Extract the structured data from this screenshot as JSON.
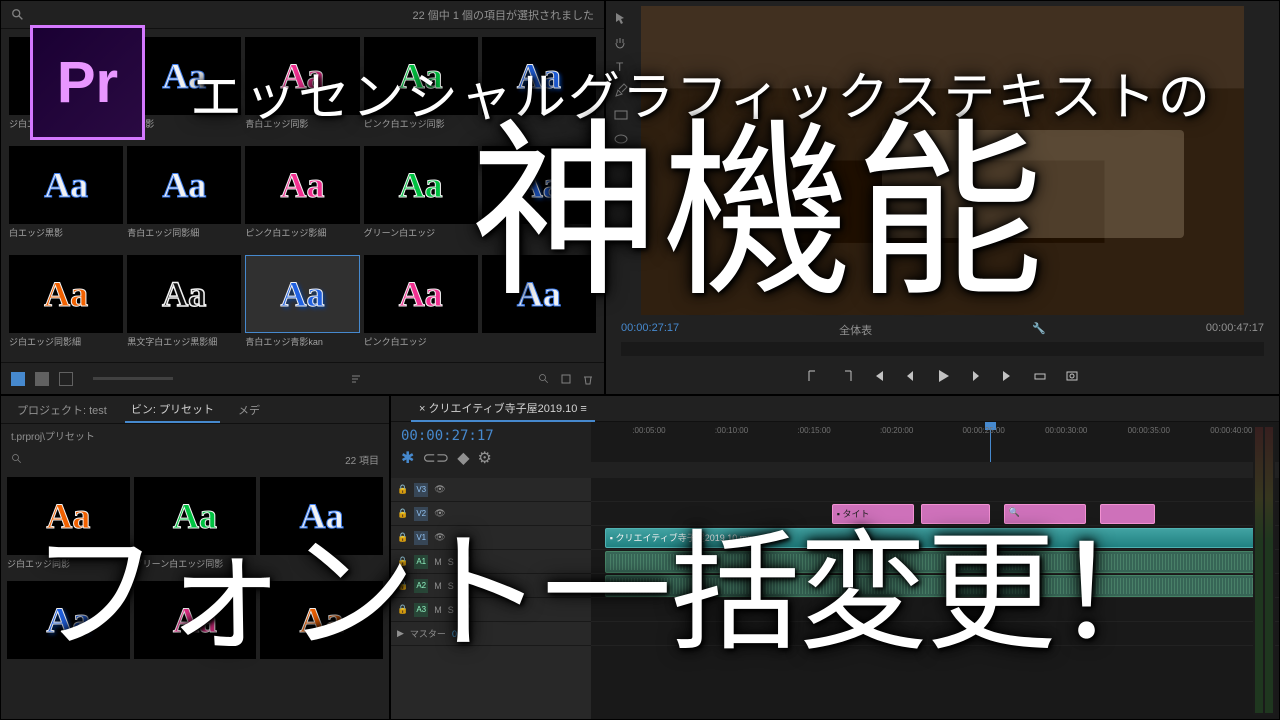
{
  "overlay": {
    "line1": "エッセンシャルグラフィックステキストの",
    "line2": "神機能",
    "line3": "フォント一括変更！"
  },
  "app_icon": "Pr",
  "presets_panel": {
    "status": "22 個中 1 個の項目が選択されました",
    "items": [
      {
        "label": "ジ白エッジ同影",
        "style": "aa-orange"
      },
      {
        "label": "ジ同影",
        "style": "aa-white"
      },
      {
        "label": "青白エッジ同影",
        "style": "aa-pink"
      },
      {
        "label": "ピンク白エッジ同影",
        "style": "aa-green"
      },
      {
        "label": "",
        "style": "aa-blue"
      },
      {
        "label": "白エッジ黒影",
        "style": "aa-white"
      },
      {
        "label": "青白エッジ同影細",
        "style": "aa-white"
      },
      {
        "label": "ピンク白エッジ影細",
        "style": "aa-pink"
      },
      {
        "label": "グリーン白エッジ",
        "style": "aa-green"
      },
      {
        "label": "",
        "style": "aa-blue"
      },
      {
        "label": "ジ白エッジ同影細",
        "style": "aa-orange"
      },
      {
        "label": "黒文字白エッジ黒影細",
        "style": "aa-blackwhite"
      },
      {
        "label": "青白エッジ青影kan",
        "style": "aa-blue",
        "selected": true
      },
      {
        "label": "ピンク白エッジ",
        "style": "aa-pink"
      },
      {
        "label": "",
        "style": "aa-white"
      }
    ]
  },
  "monitor": {
    "timecode": "00:00:27:17",
    "fit_label": "全体表",
    "duration": "00:00:47:17"
  },
  "project": {
    "label": "プロジェクト: test",
    "bin_tab": "ビン: プリセット",
    "media_tab": "メデ",
    "path": "t.prproj\\プリセット",
    "item_count": "22 項目",
    "items": [
      {
        "label": "ジ白エッジ同影",
        "style": "aa-orange"
      },
      {
        "label": "グリーン白エッジ同影",
        "style": "aa-green"
      },
      {
        "label": "",
        "style": "aa-white"
      },
      {
        "label": "",
        "style": "aa-blue"
      },
      {
        "label": "",
        "style": "aa-pink"
      },
      {
        "label": "",
        "style": "aa-orange"
      }
    ]
  },
  "timeline": {
    "tab": "クリエイティブ寺子屋2019.10",
    "timecode": "00:00:27:17",
    "ruler": [
      ":00:05:00",
      ":00:10:00",
      ":00:15:00",
      ":00:20:00",
      "00:00:25:00",
      "00:00:30:00",
      "00:00:35:00",
      "00:00:40:00"
    ],
    "tracks": {
      "v3": "V3",
      "v2": "V2",
      "v1": "V1",
      "a1": "A1",
      "a2": "A2",
      "a3": "A3",
      "master": "マスター",
      "master_val": "0.0"
    },
    "clips": {
      "title1": "タイト",
      "video": "クリエイティブ寺子屋2019.10.mp"
    },
    "letters": {
      "m": "M",
      "s": "S",
      "o": "O"
    }
  }
}
